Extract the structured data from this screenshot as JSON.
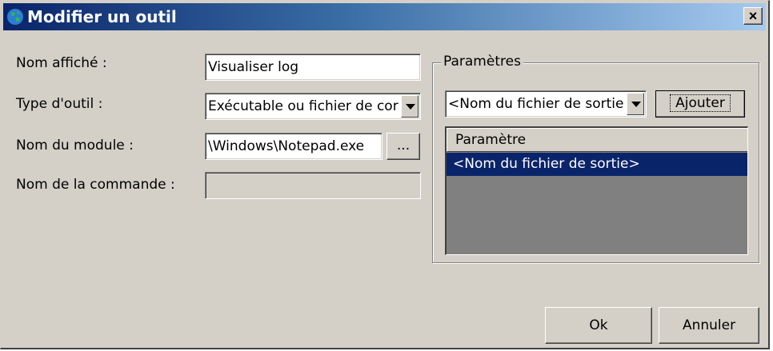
{
  "window": {
    "title": "Modifier un outil",
    "close_glyph": "×"
  },
  "form": {
    "display_name_label": "Nom affiché :",
    "display_name_value": "Visualiser log",
    "tool_type_label": "Type d'outil :",
    "tool_type_value": "Exécutable ou fichier de cor",
    "module_name_label": "Nom du module :",
    "module_name_value": "\\Windows\\Notepad.exe",
    "browse_label": "...",
    "command_name_label": "Nom de la commande :",
    "command_name_value": ""
  },
  "parameters": {
    "group_label": "Paramètres",
    "select_value": "<Nom du fichier de sortie",
    "add_button": "Ajouter",
    "list_header": "Paramètre",
    "items": [
      "<Nom du fichier de sortie>"
    ]
  },
  "footer": {
    "ok_label": "Ok",
    "cancel_label": "Annuler"
  }
}
